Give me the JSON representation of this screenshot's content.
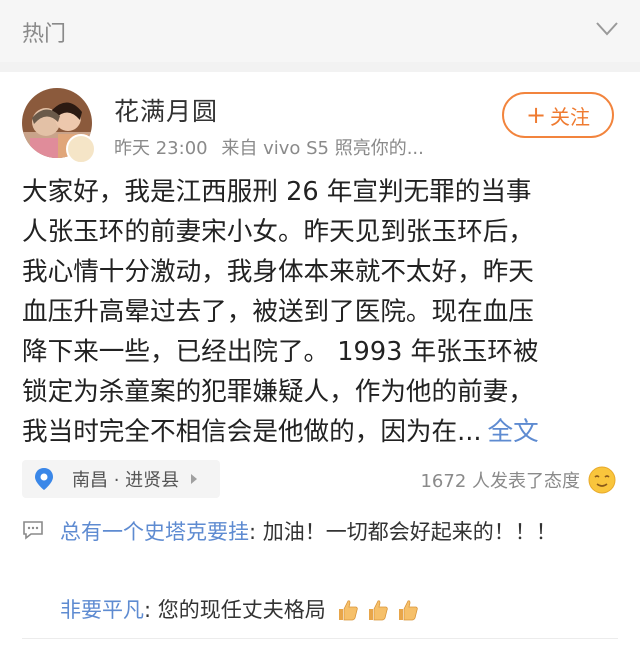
{
  "section": {
    "title": "热门"
  },
  "post": {
    "user": {
      "name": "花满月圆",
      "time": "昨天 23:00",
      "source": "来自 vivo S5 照亮你的..."
    },
    "follow_button": {
      "plus": "+",
      "label": "关注"
    },
    "body_lines": [
      "大家好，我是江西服刑 26 年宣判无罪的当事",
      "人张玉环的前妻宋小女。昨天见到张玉环后，",
      "我心情十分激动，我身体本来就不太好，昨天",
      "血压升高晕过去了，被送到了医院。现在血压",
      "降下来一些，已经出院了。 1993 年张玉环被",
      "锁定为杀童案的犯罪嫌疑人，作为他的前妻，",
      "我当时完全不相信会是他做的，因为在..."
    ],
    "full_text_link": "全文",
    "location": "南昌 · 进贤县",
    "reactions_text": "1672 人发表了态度"
  },
  "comments": [
    {
      "user": "总有一个史塔克要挂",
      "text": ": 加油！一切都会好起来的！！！"
    },
    {
      "user": "非要平凡",
      "text": ": 您的现任丈夫格局"
    }
  ],
  "colors": {
    "accent_orange": "#ef7b31",
    "link_blue": "#5e8bd1",
    "muted_gray": "#8a8a8a",
    "location_pin": "#3a87e8"
  }
}
